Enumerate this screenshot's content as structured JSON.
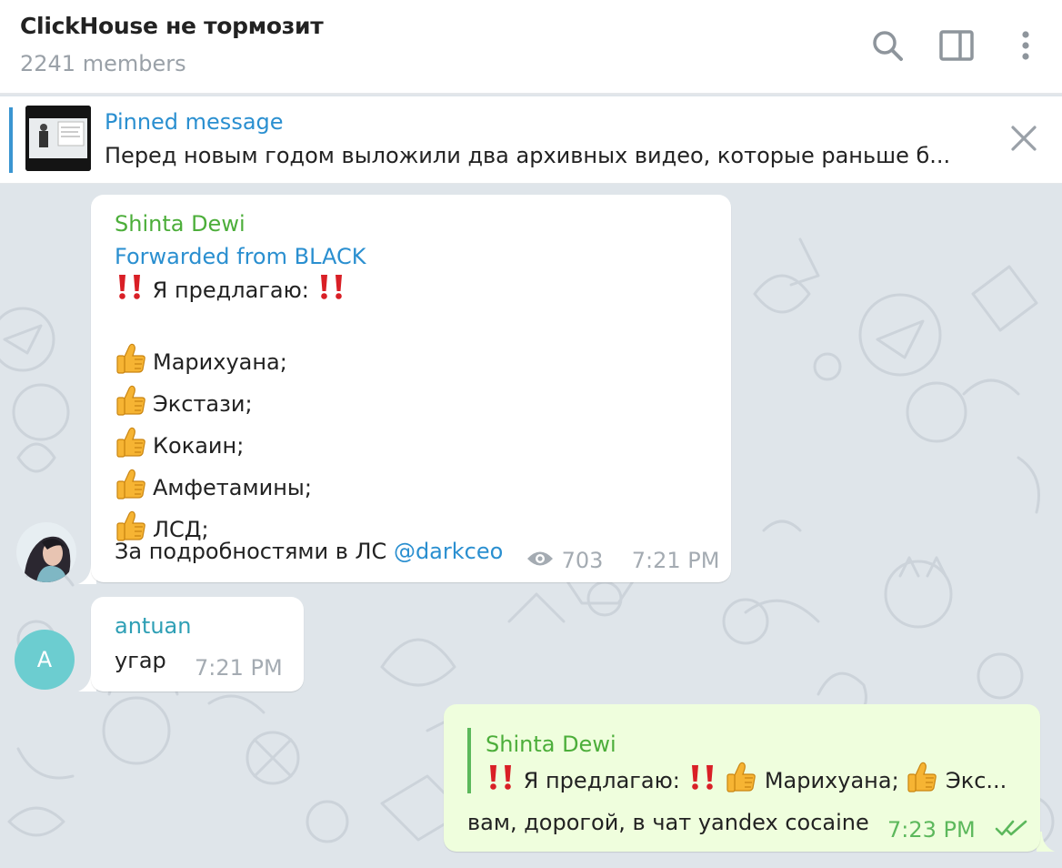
{
  "header": {
    "title": "ClickHouse не тормозит",
    "subtitle": "2241 members",
    "icons": [
      "search-icon",
      "sidebar-toggle-icon",
      "more-icon"
    ]
  },
  "pinned": {
    "title": "Pinned message",
    "text": "Перед новым годом выложили два архивных видео, которые раньше б..."
  },
  "messages": [
    {
      "sender": "Shinta Dewi",
      "forwarded": "Forwarded from BLACK",
      "line_offer": "Я предлагаю:",
      "items": [
        "Марихуана;",
        "Экстази;",
        "Кокаин;",
        "Амфетамины;",
        "ЛСД;"
      ],
      "contact_text": "За подробностями в ЛС ",
      "contact_link": "@darkceo",
      "views": "703",
      "time": "7:21 PM",
      "sender_color": "#4cae3a"
    },
    {
      "sender": "antuan",
      "avatar_letter": "A",
      "text": "угар",
      "time": "7:21 PM",
      "sender_color": "#2e9fb5",
      "avatar_color": "#6ccdd0"
    },
    {
      "reply_sender": "Shinta Dewi",
      "reply_part1": "Я предлагаю:",
      "reply_part2": "Марихуана;",
      "reply_part3": "Экс...",
      "text": "вам, дорогой, в чат yandex cocaine",
      "time": "7:23 PM",
      "bubble_color": "#effedd",
      "meta_color": "#5cb85c"
    }
  ]
}
